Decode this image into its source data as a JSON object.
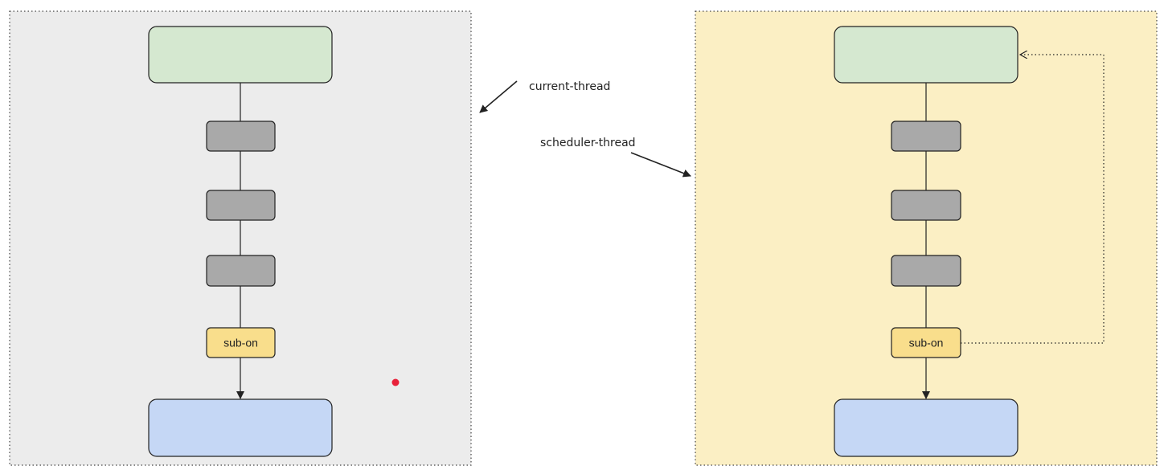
{
  "panels": {
    "left": {
      "background": "#ececec",
      "border": "#444444"
    },
    "right": {
      "background": "#fbefc4",
      "border": "#444444"
    }
  },
  "nodes": {
    "source_fill": "#d5e8d0",
    "operator_fill": "#a9a9a9",
    "sink_fill": "#c5d7f5",
    "sub_on_fill": "#f9de8c",
    "sub_on_label": "sub-on"
  },
  "callouts": {
    "current_thread": "current-thread",
    "scheduler_thread": "scheduler-thread"
  },
  "marker": {
    "color": "#e8213a"
  }
}
